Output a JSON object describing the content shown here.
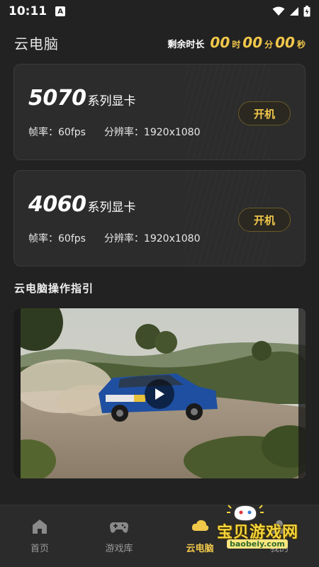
{
  "status": {
    "time": "10:11",
    "notification_letter": "A"
  },
  "header": {
    "title": "云电脑",
    "timer_label": "剩余时长",
    "hours": "00",
    "hours_unit": "时",
    "minutes": "00",
    "minutes_unit": "分",
    "seconds": "00",
    "seconds_unit": "秒"
  },
  "cards": [
    {
      "model": "5070",
      "suffix": "系列显卡",
      "fps": "帧率：60fps",
      "resolution": "分辨率：1920x1080",
      "button": "开机"
    },
    {
      "model": "4060",
      "suffix": "系列显卡",
      "fps": "帧率：60fps",
      "resolution": "分辨率：1920x1080",
      "button": "开机"
    }
  ],
  "guide": {
    "title": "云电脑操作指引"
  },
  "nav": [
    {
      "label": "首页",
      "icon": "home-icon"
    },
    {
      "label": "游戏库",
      "icon": "gamepad-icon"
    },
    {
      "label": "云电脑",
      "icon": "cloud-pc-icon"
    },
    {
      "label": "我的",
      "icon": "user-icon"
    }
  ],
  "watermark": {
    "text": "宝贝游戏网",
    "url": "baobeiy.com"
  },
  "colors": {
    "accent": "#f2c84b",
    "background": "#222222",
    "card": "#2c2c2c"
  }
}
